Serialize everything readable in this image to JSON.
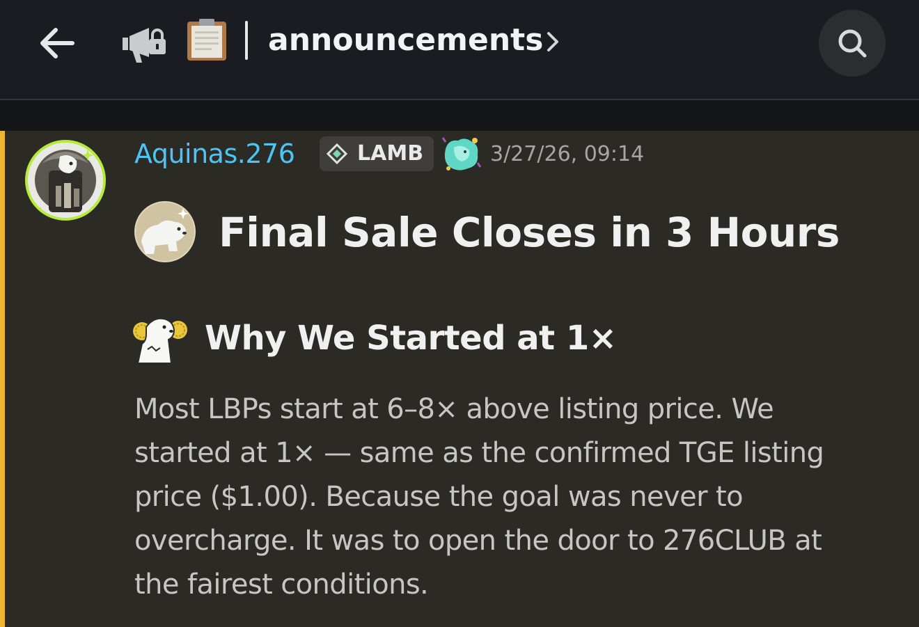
{
  "header": {
    "channel_name": "announcements",
    "icons": {
      "back": "arrow-left-icon",
      "channel_type": "announcement-megaphone-icon",
      "channel_emoji": "clipboard-icon",
      "chevron": "chevron-right-icon",
      "search": "search-icon"
    }
  },
  "message": {
    "author": {
      "username": "Aquinas.276",
      "username_color": "#4cc4f4",
      "avatar_icon": "avatar-image",
      "avatar_ring_color": "#b8ea3c"
    },
    "tag": {
      "icon": "diamond-icon",
      "label": "LAMB"
    },
    "role_icon": "role-badge-icon",
    "timestamp": "3/27/26, 09:14",
    "highlight_color": "#f0b232",
    "title_emoji": "polar-bear-emoji",
    "title": "Final Sale Closes in 3 Hours",
    "subtitle_emoji": "cheering-bear-emoji",
    "subtitle": "Why We Started at 1×",
    "body_lines": [
      "Most LBPs start at 6–8× above listing price. We",
      "started at 1× — same as the confirmed TGE listing",
      "price ($1.00). Because the goal was never to",
      "overcharge. It was to open the door to 276CLUB at",
      "the fairest conditions."
    ]
  }
}
